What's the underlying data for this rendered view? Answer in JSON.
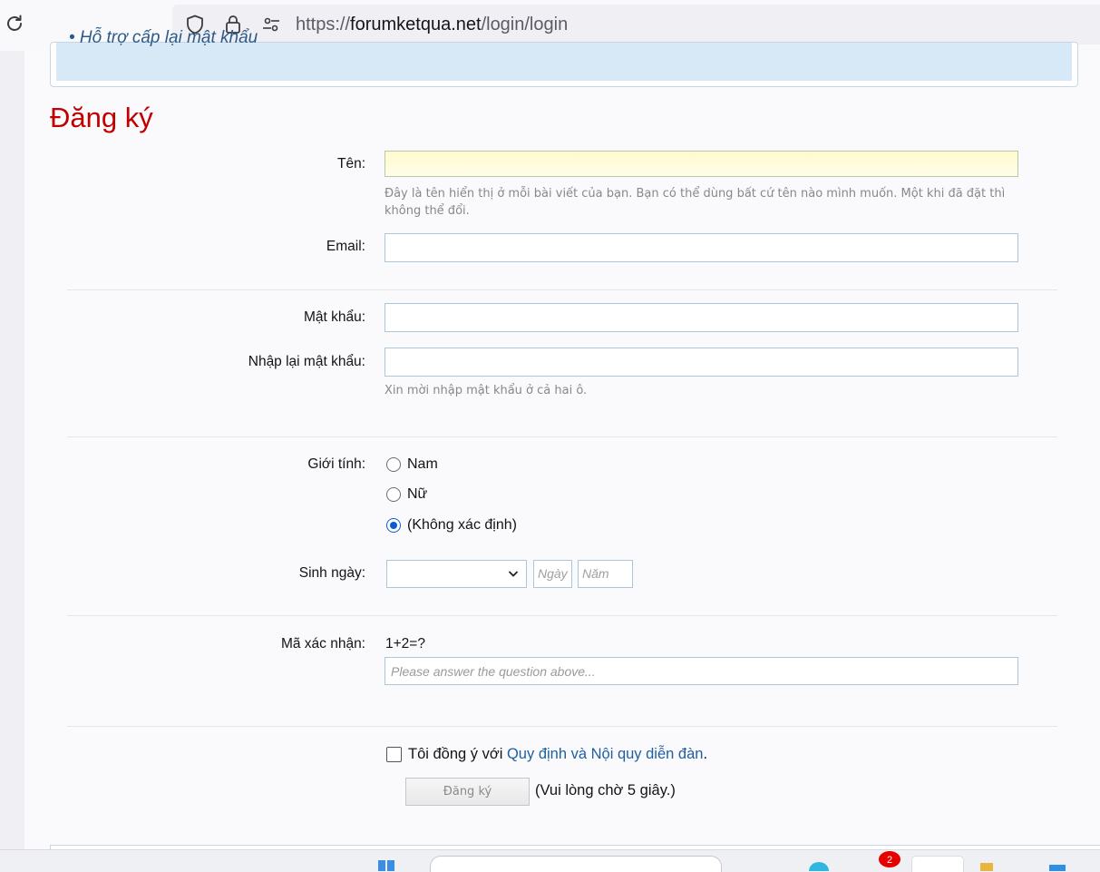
{
  "browser": {
    "url_prefix": "https://",
    "url_host": "forumketqua.net",
    "url_path": "/login/login"
  },
  "infobox": {
    "item": "• Hỗ trợ cấp lại mật khẩu"
  },
  "form": {
    "title": "Đăng ký",
    "name_label": "Tên:",
    "name_hint": "Đây là tên hiển thị ở mỗi bài viết của bạn. Bạn có thể dùng bất cứ tên nào mình muốn. Một khi đã đặt thì không thể đổi.",
    "email_label": "Email:",
    "password_label": "Mật khẩu:",
    "password_confirm_label": "Nhập lại mật khẩu:",
    "password_hint": "Xin mời nhập mật khẩu ở cả hai ô.",
    "gender_label": "Giới tính:",
    "gender_options": [
      "Nam",
      "Nữ",
      "(Không xác định)"
    ],
    "gender_selected": "(Không xác định)",
    "dob_label": "Sinh ngày:",
    "dob_month_value": "",
    "dob_day_placeholder": "Ngày",
    "dob_year_placeholder": "Năm",
    "captcha_label": "Mã xác nhận:",
    "captcha_question": "1+2=?",
    "captcha_placeholder": "Please answer the question above...",
    "agree_prefix": "Tôi đồng ý với ",
    "agree_link": "Quy định và Nội quy diễn đàn",
    "agree_suffix": ".",
    "submit_label": "Đăng ký",
    "wait_text": "(Vui lòng chờ 5 giây.)"
  },
  "taskbar": {
    "notification_count": "2"
  },
  "colors": {
    "title": "#c00000",
    "link": "#1e5fa0",
    "radio_checked": "#0b5ccf",
    "info_background": "#d7e8f7"
  }
}
